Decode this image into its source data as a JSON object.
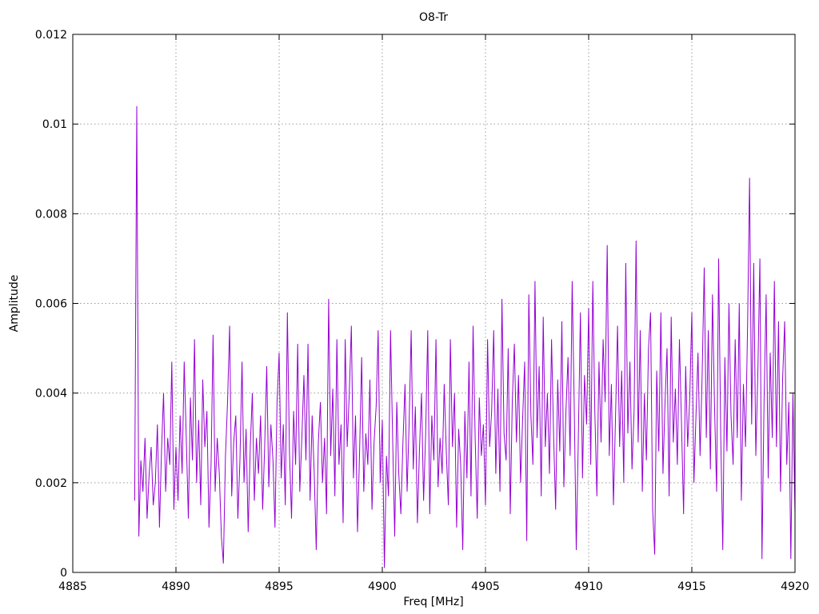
{
  "window": {
    "background": "#ffffff"
  },
  "colors": {
    "line": "#9400d3",
    "grid": "#9c9c9c",
    "axis": "#000000",
    "text": "#000000",
    "background": "#ffffff"
  },
  "chart_data": {
    "type": "line",
    "title": "O8-Tr",
    "xlabel": "Freq [MHz]",
    "ylabel": "Amplitude",
    "xlim": [
      4885,
      4920
    ],
    "ylim": [
      0,
      0.012
    ],
    "x_ticks": [
      4885,
      4890,
      4895,
      4900,
      4905,
      4910,
      4915,
      4920
    ],
    "x_tick_labels": [
      "4885",
      "4890",
      "4895",
      "4900",
      "4905",
      "4910",
      "4915",
      "4920"
    ],
    "y_ticks": [
      0,
      0.002,
      0.004,
      0.006,
      0.008,
      0.01,
      0.012
    ],
    "y_tick_labels": [
      "0",
      "0.002",
      "0.004",
      "0.006",
      "0.008",
      "0.01",
      "0.012"
    ],
    "grid": true,
    "grid_style": "dotted",
    "legend": "none",
    "line_color": "#9400d3",
    "series": [
      {
        "name": "O8-Tr",
        "x_start": 4888.0,
        "x_step": 0.1,
        "amp_scale": 0.0001,
        "values": [
          16,
          104,
          8,
          25,
          18,
          30,
          12,
          22,
          28,
          15,
          20,
          33,
          10,
          27,
          40,
          18,
          30,
          24,
          47,
          14,
          28,
          16,
          35,
          22,
          47,
          30,
          12,
          39,
          25,
          52,
          20,
          34,
          15,
          43,
          28,
          36,
          10,
          24,
          53,
          18,
          30,
          22,
          8,
          2,
          26,
          38,
          55,
          17,
          29,
          35,
          12,
          25,
          47,
          20,
          32,
          9,
          28,
          40,
          16,
          30,
          22,
          35,
          14,
          28,
          46,
          19,
          33,
          25,
          10,
          38,
          49,
          21,
          33,
          15,
          58,
          27,
          12,
          36,
          24,
          51,
          18,
          30,
          44,
          25,
          51,
          16,
          35,
          22,
          5,
          29,
          38,
          20,
          30,
          13,
          61,
          26,
          41,
          17,
          52,
          24,
          33,
          11,
          52,
          28,
          40,
          55,
          21,
          35,
          9,
          27,
          48,
          18,
          31,
          24,
          43,
          14,
          29,
          37,
          54,
          20,
          34,
          1,
          26,
          17,
          54,
          30,
          8,
          38,
          22,
          13,
          29,
          42,
          18,
          33,
          54,
          23,
          37,
          11,
          27,
          40,
          16,
          31,
          54,
          13,
          35,
          25,
          52,
          19,
          30,
          22,
          42,
          27,
          15,
          52,
          28,
          40,
          10,
          32,
          24,
          5,
          36,
          21,
          47,
          17,
          55,
          30,
          12,
          39,
          26,
          33,
          15,
          52,
          28,
          36,
          54,
          22,
          41,
          18,
          61,
          31,
          25,
          50,
          13,
          38,
          51,
          29,
          44,
          20,
          34,
          47,
          7,
          62,
          35,
          24,
          65,
          30,
          46,
          17,
          57,
          28,
          40,
          22,
          52,
          31,
          14,
          43,
          27,
          56,
          19,
          36,
          48,
          26,
          65,
          38,
          5,
          30,
          58,
          21,
          44,
          33,
          59,
          24,
          65,
          36,
          17,
          47,
          29,
          52,
          38,
          73,
          26,
          42,
          15,
          34,
          55,
          28,
          45,
          20,
          69,
          31,
          47,
          23,
          36,
          74,
          29,
          54,
          18,
          40,
          25,
          50,
          58,
          14,
          4,
          45,
          27,
          58,
          22,
          38,
          50,
          17,
          57,
          29,
          41,
          24,
          52,
          33,
          13,
          46,
          28,
          39,
          58,
          20,
          35,
          49,
          26,
          44,
          68,
          30,
          54,
          23,
          62,
          37,
          18,
          70,
          31,
          5,
          48,
          27,
          60,
          35,
          24,
          52,
          30,
          60,
          16,
          42,
          28,
          55,
          88,
          33,
          69,
          26,
          45,
          70,
          3,
          38,
          62,
          21,
          49,
          30,
          65,
          28,
          56,
          18,
          43,
          56,
          24,
          38,
          3,
          40,
          13
        ]
      }
    ]
  }
}
